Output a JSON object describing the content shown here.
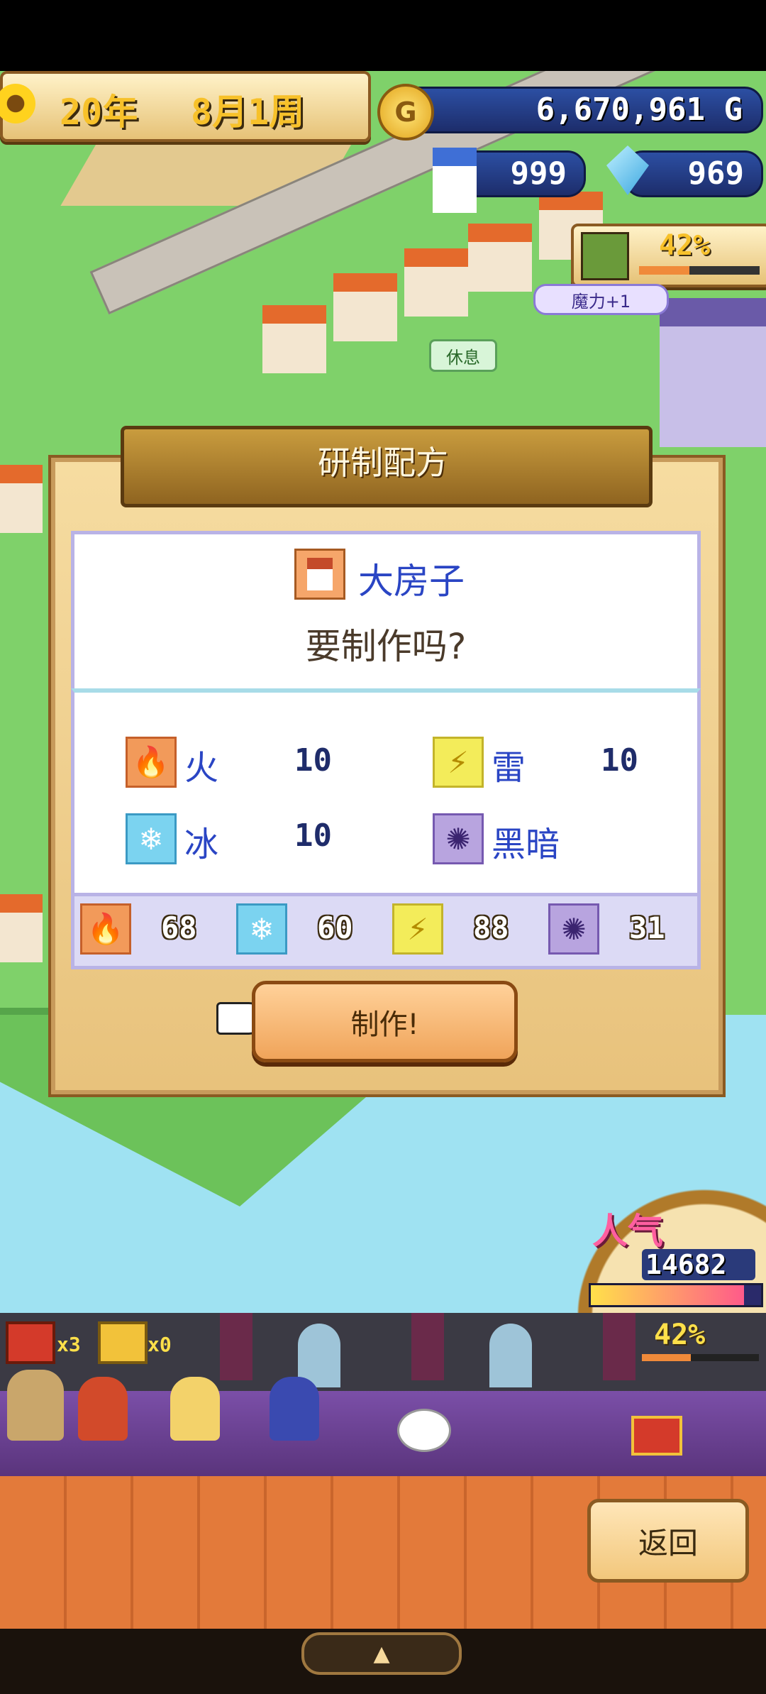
{
  "hud": {
    "date_year": "20年",
    "date_week": "8月1周",
    "gold": "6,670,961 G",
    "gold_icon": "coin-icon",
    "house_count": "999",
    "crystal_count": "969",
    "facility_percent": "42%",
    "magic_bonus": "魔力+1",
    "resting_label": "休息"
  },
  "dialog": {
    "title": "研制配方",
    "item_name": "大房子",
    "prompt": "要制作吗?",
    "costs": [
      {
        "name": "火",
        "amount": "10",
        "icon": "fire-icon"
      },
      {
        "name": "雷",
        "amount": "10",
        "icon": "thunder-icon"
      },
      {
        "name": "冰",
        "amount": "10",
        "icon": "ice-icon"
      },
      {
        "name": "黑暗",
        "amount": "",
        "icon": "dark-icon"
      }
    ],
    "stock": [
      {
        "icon": "fire-icon",
        "amount": "68"
      },
      {
        "icon": "ice-icon",
        "amount": "60"
      },
      {
        "icon": "thunder-icon",
        "amount": "88"
      },
      {
        "icon": "dark-icon",
        "amount": "31"
      }
    ],
    "make_label": "制作!"
  },
  "popularity": {
    "label": "人气",
    "value": "14682",
    "fill": 0.9
  },
  "hall": {
    "chest_red_count": "x3",
    "chest_gold_count": "x0",
    "progress_percent": "42%",
    "progress_fill": 0.42
  },
  "nav": {
    "back_label": "返回",
    "drawer_symbol": "▲",
    "side_arrow": "▶"
  },
  "colors": {
    "accent_blue": "#2a45c4",
    "panel_border": "#b9b3e6",
    "button_orange": "#f0a45a"
  }
}
